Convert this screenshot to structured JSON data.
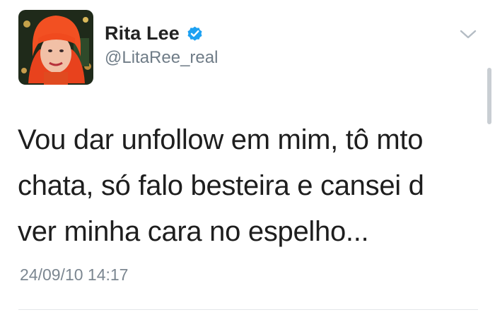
{
  "tweet": {
    "author": {
      "display_name": "Rita Lee",
      "handle": "@LitaRee_real",
      "verified": true,
      "avatar_icon": "avatar-red-hair-portrait"
    },
    "text_lines": [
      "Vou dar unfollow em mim, tô mto",
      "chata, só falo besteira e cansei d",
      "ver minha cara no espelho..."
    ],
    "timestamp": "24/09/10 14:17",
    "menu_icon": "chevron-down-icon"
  },
  "colors": {
    "verified_badge": "#1da1f2",
    "handle": "#6f7c87",
    "timestamp": "#7c8791",
    "text": "#1e1e1e"
  }
}
